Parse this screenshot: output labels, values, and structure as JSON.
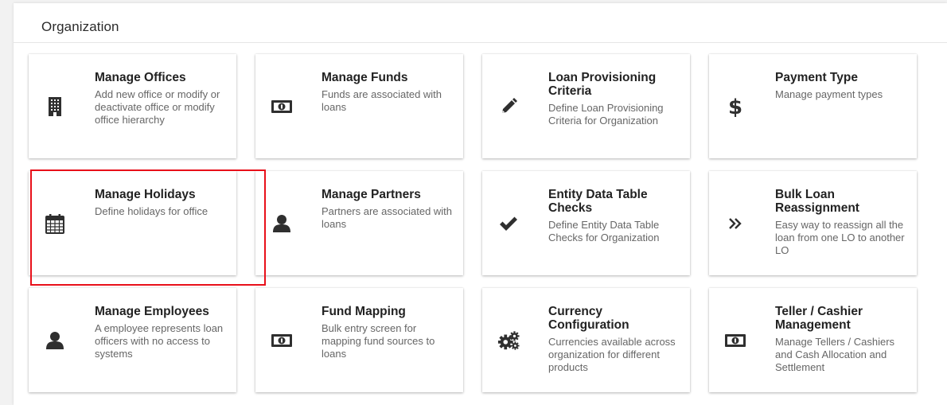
{
  "section": {
    "title": "Organization"
  },
  "cards": [
    {
      "id": "manage-offices",
      "icon": "building-icon",
      "title": "Manage Offices",
      "description": "Add new office or modify or deactivate office or modify office hierarchy"
    },
    {
      "id": "manage-funds",
      "icon": "money-icon",
      "title": "Manage Funds",
      "description": "Funds are associated with loans"
    },
    {
      "id": "loan-provisioning-criteria",
      "icon": "pencil-icon",
      "title": "Loan Provisioning Criteria",
      "description": "Define Loan Provisioning Criteria for Organization"
    },
    {
      "id": "payment-type",
      "icon": "dollar-icon",
      "title": "Payment Type",
      "description": "Manage payment types"
    },
    {
      "id": "manage-holidays",
      "icon": "calendar-icon",
      "title": "Manage Holidays",
      "description": "Define holidays for office"
    },
    {
      "id": "manage-partners",
      "icon": "user-icon",
      "title": "Manage Partners",
      "description": "Partners are associated with loans"
    },
    {
      "id": "entity-data-table-checks",
      "icon": "check-icon",
      "title": "Entity Data Table Checks",
      "description": "Define Entity Data Table Checks for Organization"
    },
    {
      "id": "bulk-loan-reassignment",
      "icon": "double-chevron-right-icon",
      "title": "Bulk Loan Reassignment",
      "description": "Easy way to reassign all the loan from one LO to another LO"
    },
    {
      "id": "manage-employees",
      "icon": "user-icon",
      "title": "Manage Employees",
      "description": "A employee represents loan officers with no access to systems"
    },
    {
      "id": "fund-mapping",
      "icon": "money-icon",
      "title": "Fund Mapping",
      "description": "Bulk entry screen for mapping fund sources to loans"
    },
    {
      "id": "currency-configuration",
      "icon": "cogs-icon",
      "title": "Currency Configuration",
      "description": "Currencies available across organization for different products"
    },
    {
      "id": "teller-cashier-management",
      "icon": "money-icon",
      "title": "Teller / Cashier Management",
      "description": "Manage Tellers / Cashiers and Cash Allocation and Settlement"
    }
  ],
  "highlighted_card": "manage-holidays",
  "colors": {
    "highlight": "#e8101a",
    "icon": "#2f2f2f",
    "title": "#222222",
    "description": "#666666"
  }
}
